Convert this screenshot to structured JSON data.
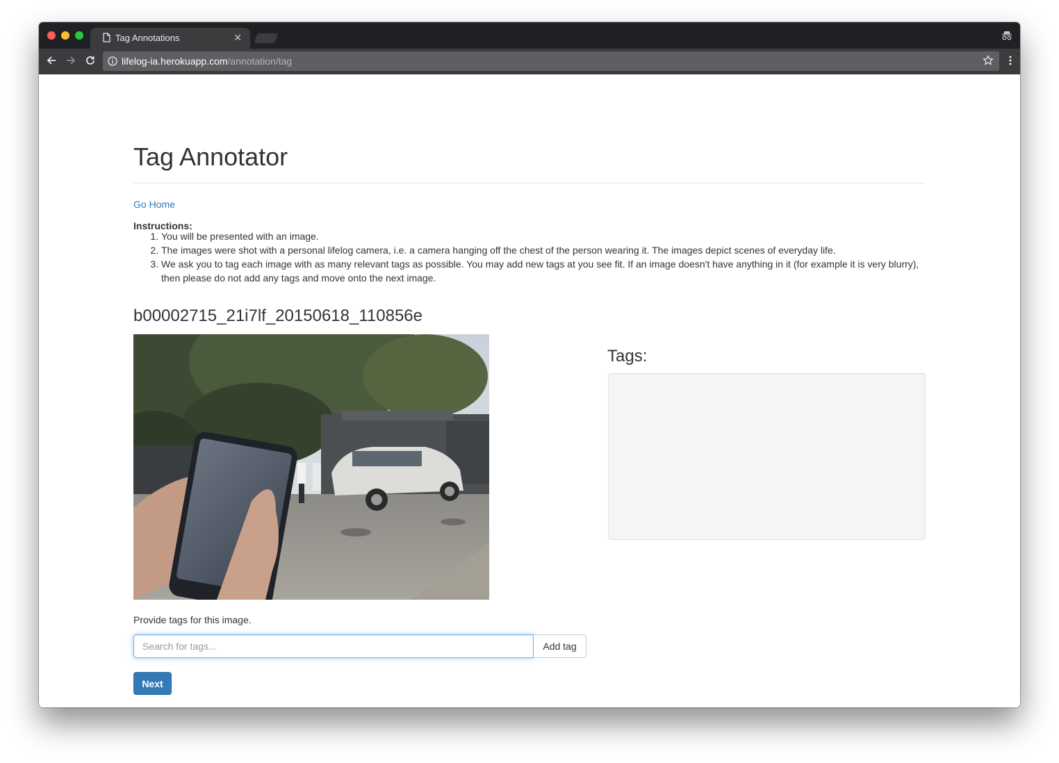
{
  "browser": {
    "tab_title": "Tag Annotations",
    "url_host": "lifelog-ia.herokuapp.com",
    "url_path": "/annotation/tag"
  },
  "page": {
    "title": "Tag Annotator",
    "go_home": "Go Home",
    "instructions_label": "Instructions:",
    "instructions": [
      "You will be presented with an image.",
      "The images were shot with a personal lifelog camera, i.e. a camera hanging off the chest of the person wearing it. The images depict scenes of everyday life.",
      "We ask you to tag each image with as many relevant tags as possible. You may add new tags at you see fit. If an image doesn't have anything in it (for example it is very blurry), then please do not add any tags and move onto the next image."
    ],
    "image_name": "b00002715_21i7lf_20150618_110856e",
    "tags_heading": "Tags:",
    "prompt": "Provide tags for this image.",
    "search_placeholder": "Search for tags...",
    "add_tag_label": "Add tag",
    "next_label": "Next"
  },
  "colors": {
    "link": "#337ab7",
    "primary_button": "#337ab7",
    "tags_box_bg": "#f5f5f5"
  }
}
